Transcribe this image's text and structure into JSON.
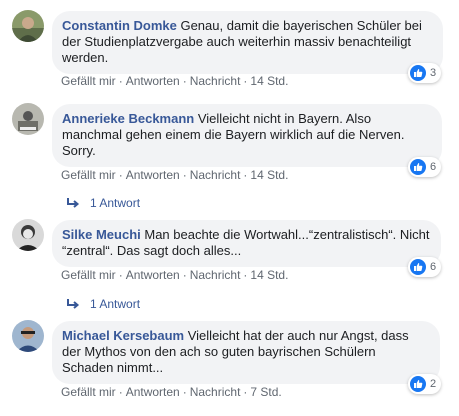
{
  "actions": {
    "like": "Gefällt mir",
    "reply": "Antworten",
    "message": "Nachricht",
    "sep": "·"
  },
  "comments": [
    {
      "author": "Constantin Domke",
      "text": "Genau, damit die bayerischen Schüler bei der Studienplatzvergabe auch weiterhin massiv benachteiligt werden.",
      "time": "14 Std.",
      "reactions": "3",
      "replies": ""
    },
    {
      "author": "Annerieke Beckmann",
      "text": "Vielleicht nicht in Bayern. Also manchmal gehen einem die Bayern wirklich auf die Nerven. Sorry.",
      "time": "14 Std.",
      "reactions": "6",
      "replies": "1 Antwort"
    },
    {
      "author": "Silke Meuchi",
      "text": "Man beachte die Wortwahl...“zentralistisch“. Nicht “zentral“. Das sagt doch alles...",
      "time": "14 Std.",
      "reactions": "6",
      "replies": "1 Antwort"
    },
    {
      "author": "Michael Kersebaum",
      "text": "Vielleicht hat der auch nur Angst, dass der Mythos von den ach so guten bayrischen Schülern Schaden nimmt...",
      "time": "7 Std.",
      "reactions": "2",
      "replies": ""
    }
  ],
  "colors": {
    "link": "#385898",
    "like_blue": "#1877f2",
    "bubble": "#f2f3f5",
    "meta": "#606770"
  }
}
